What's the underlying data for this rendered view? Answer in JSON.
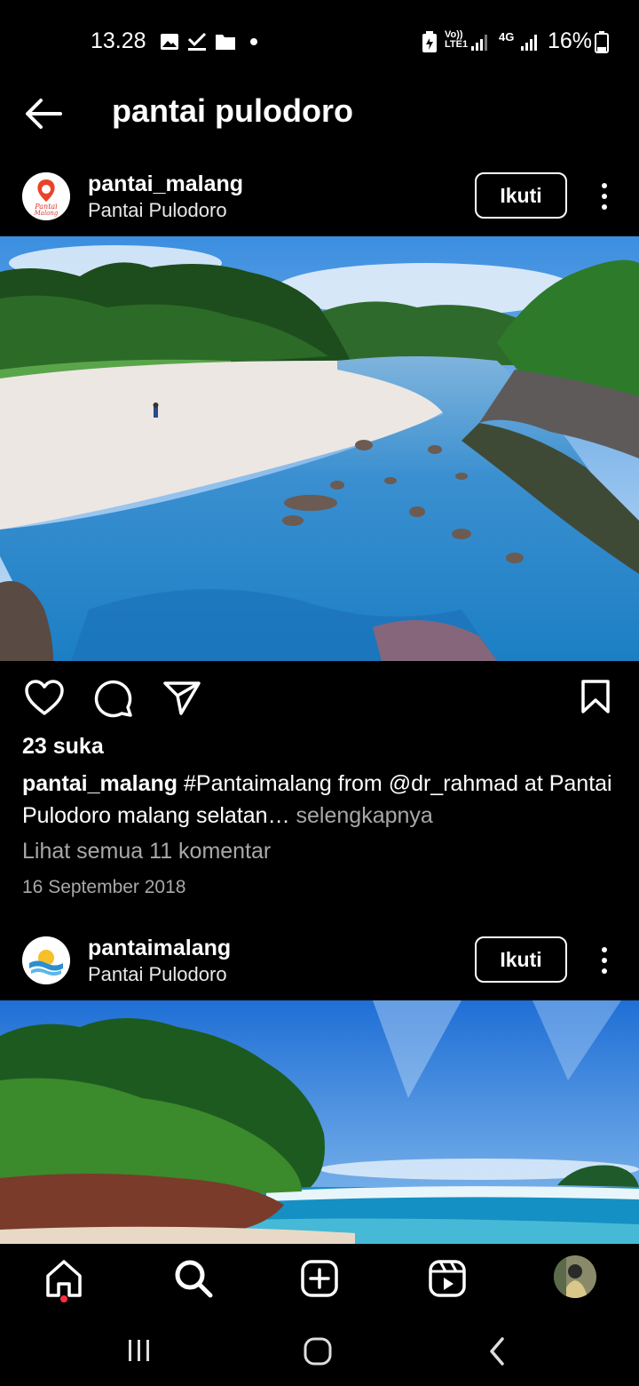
{
  "status_bar": {
    "time": "13.28",
    "network_labels": {
      "volte": "Vo)) LTE1",
      "data": "4G"
    },
    "battery": "16%"
  },
  "header": {
    "title": "pantai pulodoro"
  },
  "posts": [
    {
      "username": "pantai_malang",
      "location": "Pantai Pulodoro",
      "follow_label": "Ikuti",
      "likes": "23 suka",
      "caption_user": "pantai_malang",
      "caption_text": "#Pantaimalang from @dr_rahmad at Pantai Pulodoro malang selatan",
      "caption_ellipsis": "…",
      "caption_more": "selengkapnya",
      "comments_link": "Lihat semua 11 komentar",
      "date": "16 September 2018",
      "avatar_text": "Pantai Malang"
    },
    {
      "username": "pantaimalang",
      "location": "Pantai Pulodoro",
      "follow_label": "Ikuti"
    }
  ],
  "icons": {
    "back": "arrow-left-icon",
    "like": "heart-icon",
    "comment": "comment-icon",
    "share": "send-icon",
    "save": "bookmark-icon",
    "nav": [
      "home-icon",
      "search-icon",
      "create-icon",
      "reels-icon",
      "profile-avatar"
    ]
  },
  "colors": {
    "background": "#000000",
    "text": "#ffffff",
    "muted": "#a8a8a8",
    "notification_dot": "#ff3040"
  }
}
